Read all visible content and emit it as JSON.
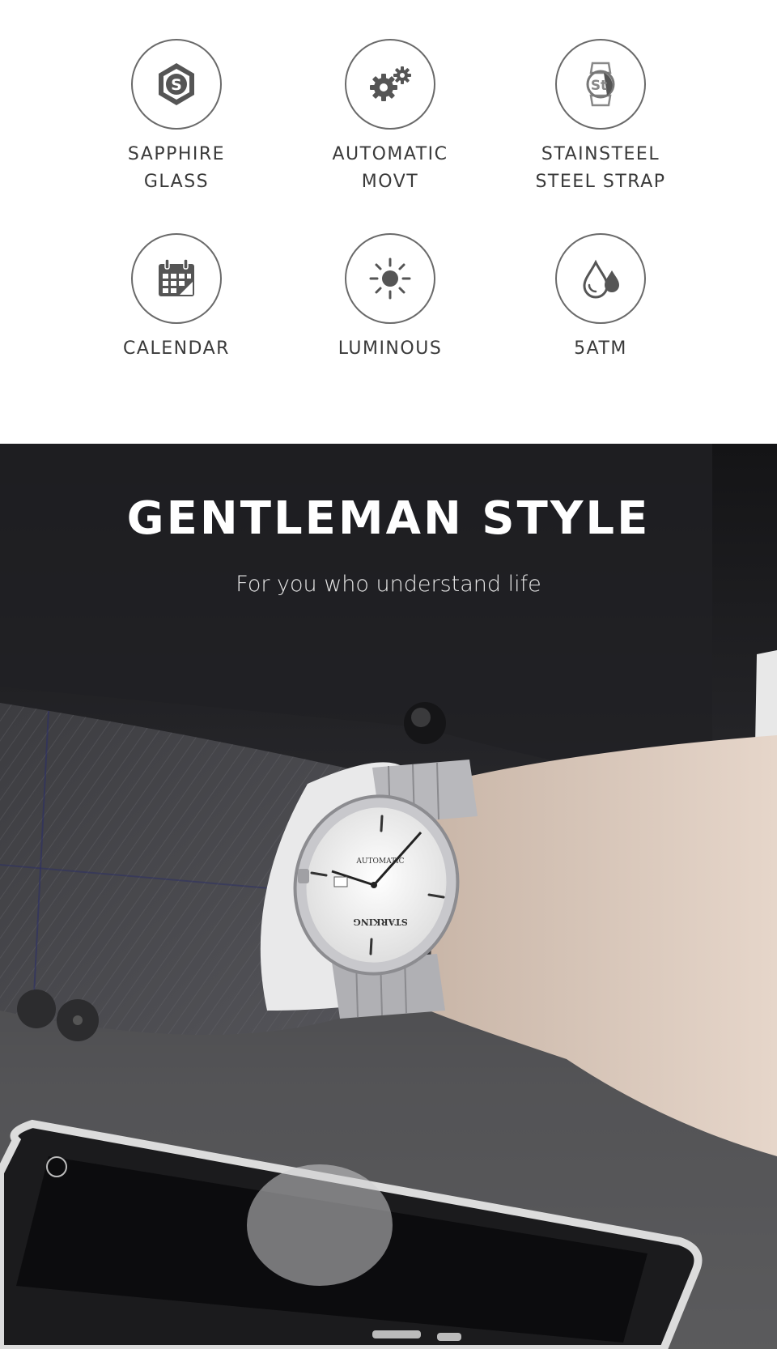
{
  "features": [
    {
      "label": "SAPPHIRE\nGLASS",
      "icon": "sapphire-glass-icon"
    },
    {
      "label": "AUTOMATIC\nMOVT",
      "icon": "gears-icon"
    },
    {
      "label": "STAINSTEEL\nSTEEL STRAP",
      "icon": "steel-strap-icon"
    },
    {
      "label": "CALENDAR",
      "icon": "calendar-icon"
    },
    {
      "label": "LUMINOUS",
      "icon": "sun-icon"
    },
    {
      "label": "5ATM",
      "icon": "water-drops-icon"
    }
  ],
  "hero": {
    "title": "GENTLEMAN STYLE",
    "subtitle": "For you who understand life"
  },
  "watch": {
    "brand": "STARKING",
    "movement": "AUTOMATIC"
  },
  "colors": {
    "icon_stroke": "#6a6a6a",
    "label_text": "#3a3a3a",
    "hero_bg": "#1c1c1e"
  }
}
